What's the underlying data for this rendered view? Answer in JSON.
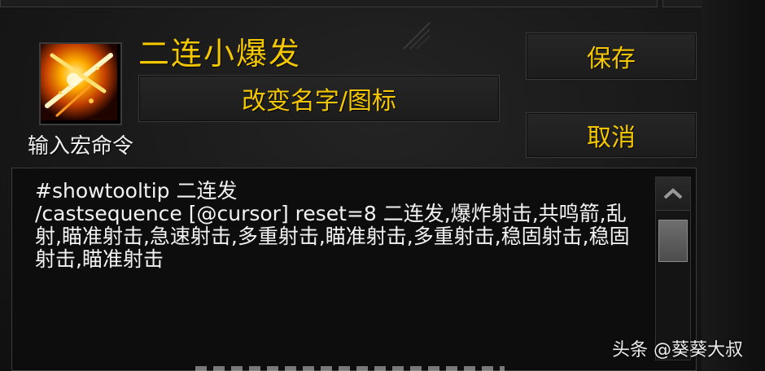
{
  "macro": {
    "name": "二连小爆发",
    "rename_label": "改变名字/图标",
    "prompt_label": "输入宏命令",
    "text": "#showtooltip 二连发\n/castsequence [@cursor] reset=8 二连发,爆炸射击,共鸣箭,乱射,瞄准射击,急速射击,多重射击,瞄准射击,多重射击,稳固射击,稳固射击,瞄准射击"
  },
  "buttons": {
    "save_label": "保存",
    "cancel_label": "取消"
  },
  "icons": {
    "macro_icon": "fire-arrows-icon",
    "scroll_up": "chevron-up-icon"
  },
  "watermark": "头条 @葵葵大叔",
  "colors": {
    "gold_text": "#f4c700",
    "background": "#181818",
    "text": "#f2f2f2"
  }
}
